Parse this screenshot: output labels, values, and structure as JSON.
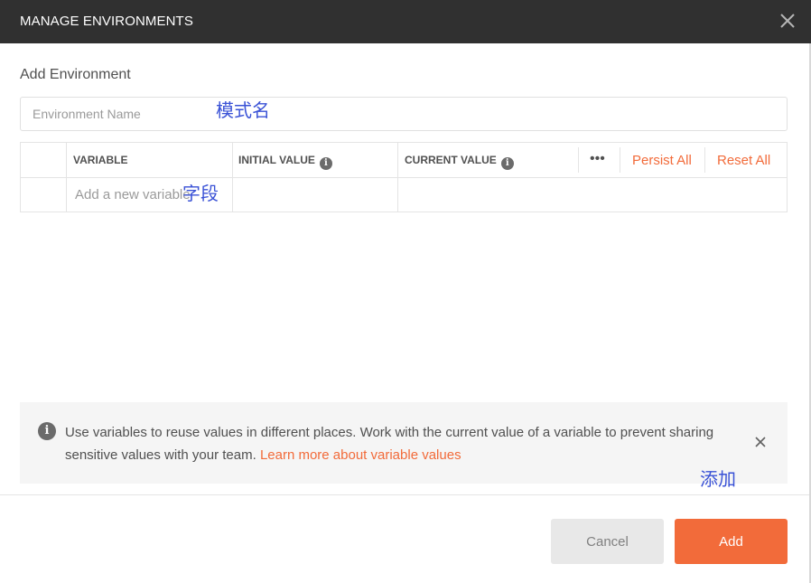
{
  "dialog": {
    "title": "MANAGE ENVIRONMENTS",
    "section_title": "Add Environment",
    "env_name_placeholder": "Environment Name"
  },
  "table": {
    "headers": {
      "variable": "VARIABLE",
      "initial_value": "INITIAL VALUE",
      "current_value": "CURRENT VALUE"
    },
    "more_label": "•••",
    "persist_all": "Persist All",
    "reset_all": "Reset All",
    "new_variable_placeholder": "Add a new variable"
  },
  "info": {
    "text": "Use variables to reuse values in different places. Work with the current value of a variable to prevent sharing sensitive values with your team.",
    "link": "Learn more about variable values"
  },
  "footer": {
    "cancel": "Cancel",
    "add": "Add"
  },
  "annotations": {
    "name": "模式名",
    "field": "字段",
    "add": "添加"
  },
  "colors": {
    "accent": "#f26b3a",
    "header_bg": "#303030",
    "annotation": "#3a52d6"
  }
}
